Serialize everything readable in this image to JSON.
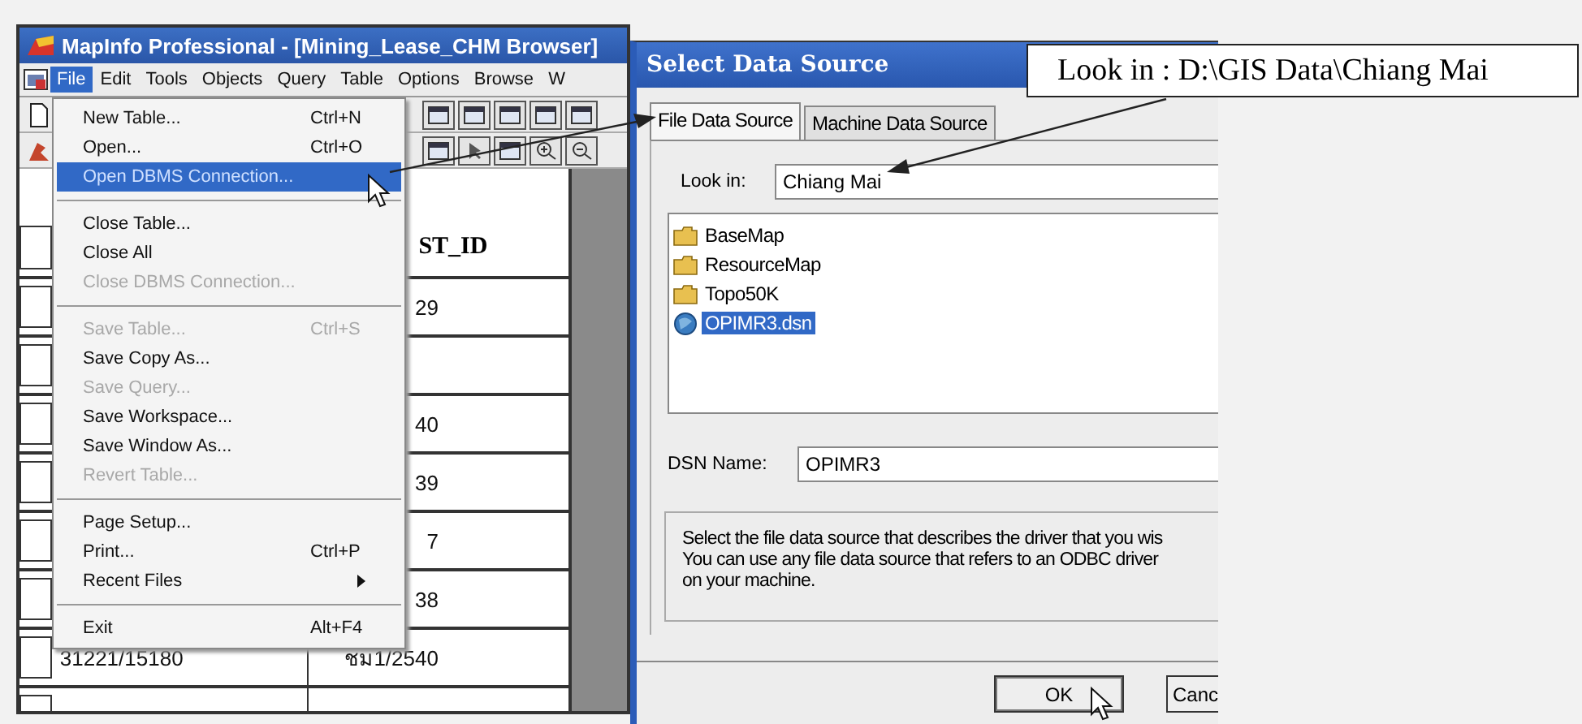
{
  "map_window": {
    "title": "MapInfo Professional - [Mining_Lease_CHM Browser]",
    "menu_bar": [
      {
        "label": "File",
        "selected": true
      },
      {
        "label": "Edit",
        "selected": false
      },
      {
        "label": "Tools",
        "selected": false
      },
      {
        "label": "Objects",
        "selected": false
      },
      {
        "label": "Query",
        "selected": false
      },
      {
        "label": "Table",
        "selected": false
      },
      {
        "label": "Options",
        "selected": false
      },
      {
        "label": "Browse",
        "selected": false
      },
      {
        "label": "W",
        "selected": false
      }
    ],
    "browser": {
      "header": "ST_ID",
      "rows": [
        {
          "column_2": "29"
        },
        {},
        {
          "column_2": "40"
        },
        {
          "column_2": "39"
        },
        {
          "column_2": "7"
        },
        {
          "column_2": "38"
        },
        {
          "column_1": "31221/15180",
          "column_2": "ชม1/2540"
        },
        {}
      ]
    }
  },
  "file_menu": {
    "items": [
      {
        "kind": "item",
        "label": "New Table...",
        "shortcut": "Ctrl+N",
        "disabled": false,
        "selected": false
      },
      {
        "kind": "item",
        "label": "Open...",
        "shortcut": "Ctrl+O",
        "disabled": false,
        "selected": false
      },
      {
        "kind": "item",
        "label": "Open DBMS Connection...",
        "disabled": false,
        "selected": true
      },
      {
        "kind": "separator"
      },
      {
        "kind": "item",
        "label": "Close Table...",
        "disabled": false,
        "selected": false
      },
      {
        "kind": "item",
        "label": "Close All",
        "disabled": false,
        "selected": false
      },
      {
        "kind": "item",
        "label": "Close DBMS Connection...",
        "disabled": true,
        "selected": false
      },
      {
        "kind": "separator"
      },
      {
        "kind": "item",
        "label": "Save Table...",
        "shortcut": "Ctrl+S",
        "disabled": true,
        "selected": false
      },
      {
        "kind": "item",
        "label": "Save Copy As...",
        "disabled": false,
        "selected": false
      },
      {
        "kind": "item",
        "label": "Save Query...",
        "disabled": true,
        "selected": false
      },
      {
        "kind": "item",
        "label": "Save Workspace...",
        "disabled": false,
        "selected": false
      },
      {
        "kind": "item",
        "label": "Save Window As...",
        "disabled": false,
        "selected": false
      },
      {
        "kind": "item",
        "label": "Revert Table...",
        "disabled": true,
        "selected": false
      },
      {
        "kind": "separator"
      },
      {
        "kind": "item",
        "label": "Page Setup...",
        "disabled": false,
        "selected": false
      },
      {
        "kind": "item",
        "label": "Print...",
        "shortcut": "Ctrl+P",
        "disabled": false,
        "selected": false
      },
      {
        "kind": "submenu",
        "label": "Recent Files",
        "disabled": false,
        "selected": false
      },
      {
        "kind": "separator"
      },
      {
        "kind": "item",
        "label": "Exit",
        "shortcut": "Alt+F4",
        "disabled": false,
        "selected": false
      }
    ]
  },
  "dialog": {
    "title": "Select Data Source",
    "tabs": [
      {
        "label": "File Data Source",
        "selected": true
      },
      {
        "label": "Machine Data Source",
        "selected": false
      }
    ],
    "look_in": {
      "label": "Look in:",
      "value": "Chiang Mai"
    },
    "files": [
      {
        "kind": "folder",
        "name": "BaseMap",
        "selected": false
      },
      {
        "kind": "folder",
        "name": "ResourceMap",
        "selected": false
      },
      {
        "kind": "folder",
        "name": "Topo50K",
        "selected": false
      },
      {
        "kind": "dsn",
        "name": "OPIMR3.dsn",
        "selected": true
      }
    ],
    "dsn_name": {
      "label": "DSN Name:",
      "value": "OPIMR3"
    },
    "description": "Select the file data source that describes the driver that you wis\nYou can use any file data source that refers to an ODBC driver\non your machine.",
    "buttons": [
      "OK",
      "Canc"
    ]
  },
  "callout": {
    "text": "Look in : D:\\GIS Data\\Chiang Mai"
  }
}
